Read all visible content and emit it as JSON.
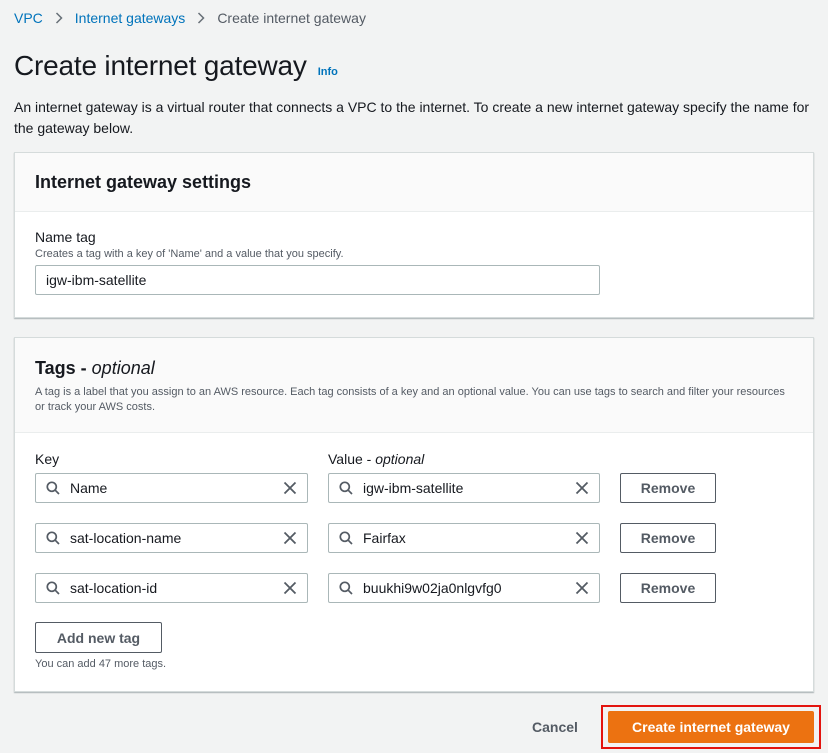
{
  "breadcrumb": {
    "items": [
      "VPC",
      "Internet gateways"
    ],
    "current": "Create internet gateway"
  },
  "header": {
    "title": "Create internet gateway",
    "info_label": "Info",
    "description": "An internet gateway is a virtual router that connects a VPC to the internet. To create a new internet gateway specify the name for the gateway below."
  },
  "settings": {
    "title": "Internet gateway settings",
    "name_label": "Name tag",
    "name_hint": "Creates a tag with a key of 'Name' and a value that you specify.",
    "name_value": "igw-ibm-satellite"
  },
  "tags": {
    "title": "Tags - ",
    "title_optional": "optional",
    "description": "A tag is a label that you assign to an AWS resource. Each tag consists of a key and an optional value. You can use tags to search and filter your resources or track your AWS costs.",
    "key_label": "Key",
    "value_label": "Value - ",
    "value_label_optional": "optional",
    "rows": [
      {
        "key": "Name",
        "value": "igw-ibm-satellite",
        "remove": "Remove"
      },
      {
        "key": "sat-location-name",
        "value": "Fairfax",
        "remove": "Remove"
      },
      {
        "key": "sat-location-id",
        "value": "buukhi9w02ja0nlgvfg0",
        "remove": "Remove"
      }
    ],
    "add_label": "Add new tag",
    "limit_text": "You can add 47 more tags."
  },
  "footer": {
    "cancel_label": "Cancel",
    "create_label": "Create internet gateway"
  },
  "colors": {
    "link": "#0073bb",
    "primary": "#ec7211",
    "highlight": "#e3140f",
    "background": "#f2f3f3"
  }
}
